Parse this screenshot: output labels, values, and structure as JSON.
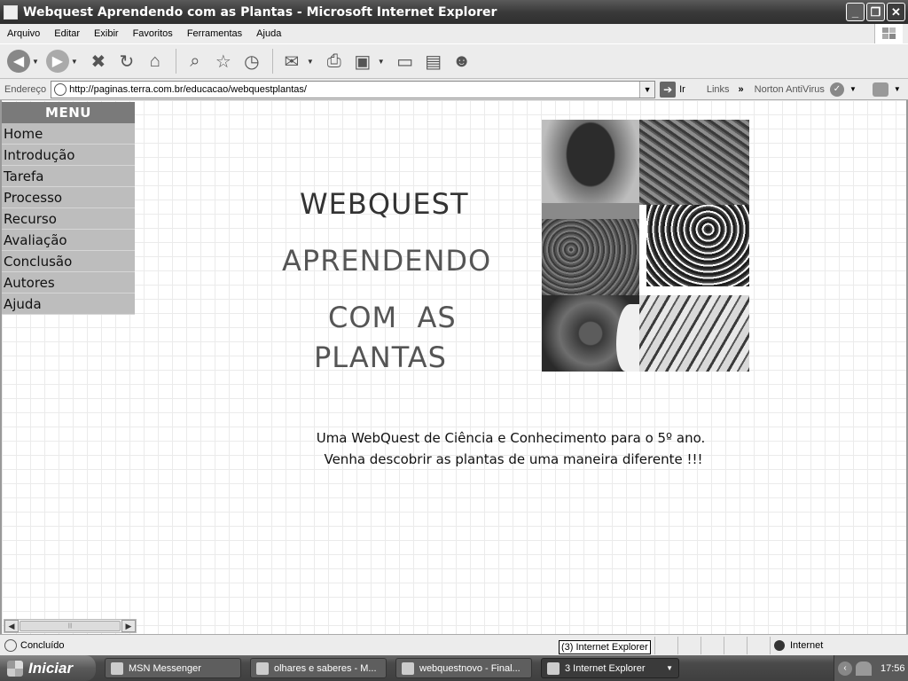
{
  "window": {
    "title": "Webquest Aprendendo com as Plantas - Microsoft Internet Explorer",
    "minimize": "_",
    "maximize": "❐",
    "close": "✕"
  },
  "menubar": [
    "Arquivo",
    "Editar",
    "Exibir",
    "Favoritos",
    "Ferramentas",
    "Ajuda"
  ],
  "toolbar": {
    "icons": [
      "back-icon",
      "forward-icon",
      "stop-icon",
      "refresh-icon",
      "home-icon",
      "search-icon",
      "favorites-icon",
      "history-icon",
      "mail-icon",
      "print-icon",
      "edit-icon",
      "discuss-icon",
      "research-icon",
      "messenger-icon"
    ]
  },
  "address": {
    "label": "Endereço",
    "url": "http://paginas.terra.com.br/educacao/webquestplantas/",
    "go_label": "Ir",
    "links_label": "Links",
    "chevron": "»",
    "norton_label": "Norton AntiVirus"
  },
  "page": {
    "menu_header": "MENU",
    "menu_items": [
      "Home",
      "Introdução",
      "Tarefa",
      "Processo",
      "Recurso",
      "Avaliação",
      "Conclusão",
      "Autores",
      "Ajuda"
    ],
    "hero": [
      "WEBQUEST",
      "APRENDENDO",
      "COM  AS",
      "PLANTAS"
    ],
    "tagline_1": "Uma WebQuest de Ciência e Conhecimento para o 5º ano.",
    "tagline_2": "Venha descobrir as plantas de uma maneira diferente !!!",
    "mosaic": [
      "tree-photo",
      "roots-photo",
      "foliage-photo",
      "branches-photo",
      "bark-photo",
      "leaves-photo"
    ]
  },
  "statusbar": {
    "status_text": "Concluído",
    "tooltip": "(3) Internet Explorer",
    "zone": "Internet"
  },
  "taskbar": {
    "start_label": "Iniciar",
    "tasks": [
      "MSN Messenger",
      "olhares e saberes - M...",
      "webquestnovo - Final...",
      "3 Internet Explorer"
    ],
    "clock": "17:56"
  }
}
